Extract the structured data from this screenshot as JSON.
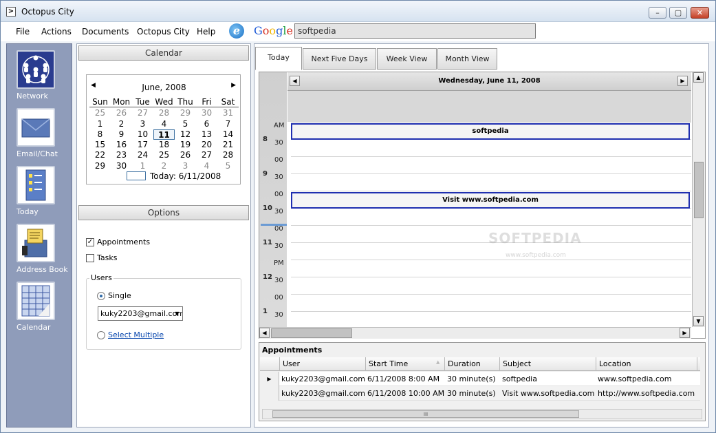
{
  "window": {
    "title": "Octopus City",
    "buttons": {
      "minimize": "–",
      "maximize": "▢",
      "close": "✕"
    }
  },
  "menu": {
    "items": [
      "File",
      "Actions",
      "Documents",
      "Octopus City",
      "Help"
    ],
    "ie_label": "e",
    "google_label": "Google",
    "search_value": "softpedia"
  },
  "nav": {
    "items": [
      {
        "label": "Network",
        "icon": "network-icon"
      },
      {
        "label": "Email/Chat",
        "icon": "envelope-icon"
      },
      {
        "label": "Today",
        "icon": "checklist-icon"
      },
      {
        "label": "Address Book",
        "icon": "address-book-icon"
      },
      {
        "label": "Calendar",
        "icon": "calendar-icon"
      }
    ]
  },
  "calendar": {
    "header": "Calendar",
    "month": "June, 2008",
    "prev": "◀",
    "next": "▶",
    "weekdays": [
      "Sun",
      "Mon",
      "Tue",
      "Wed",
      "Thu",
      "Fri",
      "Sat"
    ],
    "weeks": [
      [
        "25",
        "26",
        "27",
        "28",
        "29",
        "30",
        "31"
      ],
      [
        "1",
        "2",
        "3",
        "4",
        "5",
        "6",
        "7"
      ],
      [
        "8",
        "9",
        "10",
        "11",
        "12",
        "13",
        "14"
      ],
      [
        "15",
        "16",
        "17",
        "18",
        "19",
        "20",
        "21"
      ],
      [
        "22",
        "23",
        "24",
        "25",
        "26",
        "27",
        "28"
      ],
      [
        "29",
        "30",
        "1",
        "2",
        "3",
        "4",
        "5"
      ]
    ],
    "today_label": "Today: 6/11/2008"
  },
  "options": {
    "header": "Options",
    "appointments_label": "Appointments",
    "appointments_checked": true,
    "tasks_label": "Tasks",
    "tasks_checked": false,
    "users_legend": "Users",
    "single_label": "Single",
    "user_value": "kuky2203@gmail.com",
    "select_multiple_label": "Select Multiple"
  },
  "tabs": [
    "Today",
    "Next Five Days",
    "Week View",
    "Month View"
  ],
  "schedule": {
    "date": "Wednesday, June 11, 2008",
    "ampm_labels": {
      "am": "AM",
      "pm": "PM"
    },
    "hours": [
      "8",
      "9",
      "10",
      "11",
      "12",
      "1"
    ],
    "half": "30",
    "zero": "00",
    "events": [
      "softpedia",
      "Visit www.softpedia.com"
    ]
  },
  "appointments": {
    "title": "Appointments",
    "columns": [
      "User",
      "Start Time",
      "Duration",
      "Subject",
      "Location"
    ],
    "rows": [
      [
        "kuky2203@gmail.com",
        "6/11/2008 8:00 AM",
        "30 minute(s)",
        "softpedia",
        "www.softpedia.com"
      ],
      [
        "kuky2203@gmail.com",
        "6/11/2008 10:00 AM",
        "30 minute(s)",
        "Visit www.softpedia.com",
        "http://www.softpedia.com"
      ]
    ],
    "scroll_grip": "III"
  },
  "watermark": {
    "main": "SOFTPEDIA",
    "sub": "www.softpedia.com"
  },
  "colors": {
    "nav_bg": "#8f9cba",
    "event_border": "#1f2fb0",
    "link": "#0645ad"
  }
}
